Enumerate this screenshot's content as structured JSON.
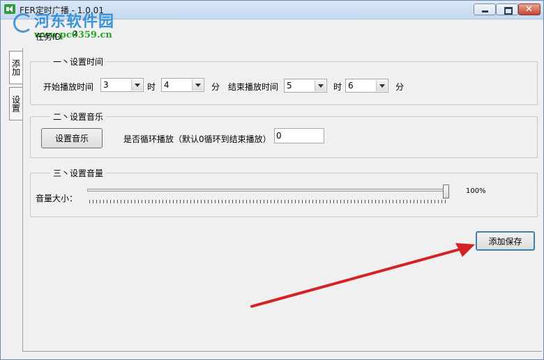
{
  "window": {
    "title": "FER定时广播 - 1.0.01"
  },
  "watermark": {
    "title": "河东软件园",
    "url": "www.pc0359.cn"
  },
  "task": {
    "label": "任务ID",
    "value": "2"
  },
  "tabs": [
    {
      "label": "添加"
    },
    {
      "label": "设置"
    }
  ],
  "time_section": {
    "title": "一丶设置时间",
    "start_label": "开始播放时间",
    "start_hour": "3",
    "hour_unit": "时",
    "start_minute": "4",
    "minute_unit": "分",
    "end_label": "结束播放时间",
    "end_hour": "5",
    "end_minute": "6"
  },
  "music_section": {
    "title": "二丶设置音乐",
    "set_music_button": "设置音乐",
    "loop_label": "是否循环播放（默认0循环到结束播放）",
    "loop_value": "0"
  },
  "volume_section": {
    "title": "三丶设置音量",
    "volume_label": "音量大小：",
    "volume_percent": 100,
    "volume_text": "100%"
  },
  "save_button": "添加保存",
  "colors": {
    "arrow": "#d32323",
    "watermark_blue": "#2a8ad6",
    "watermark_green": "#2aa52a"
  },
  "icons": {
    "minimize": "minimize-icon",
    "maximize": "maximize-icon",
    "close": "close-icon",
    "app": "speaker-icon"
  }
}
